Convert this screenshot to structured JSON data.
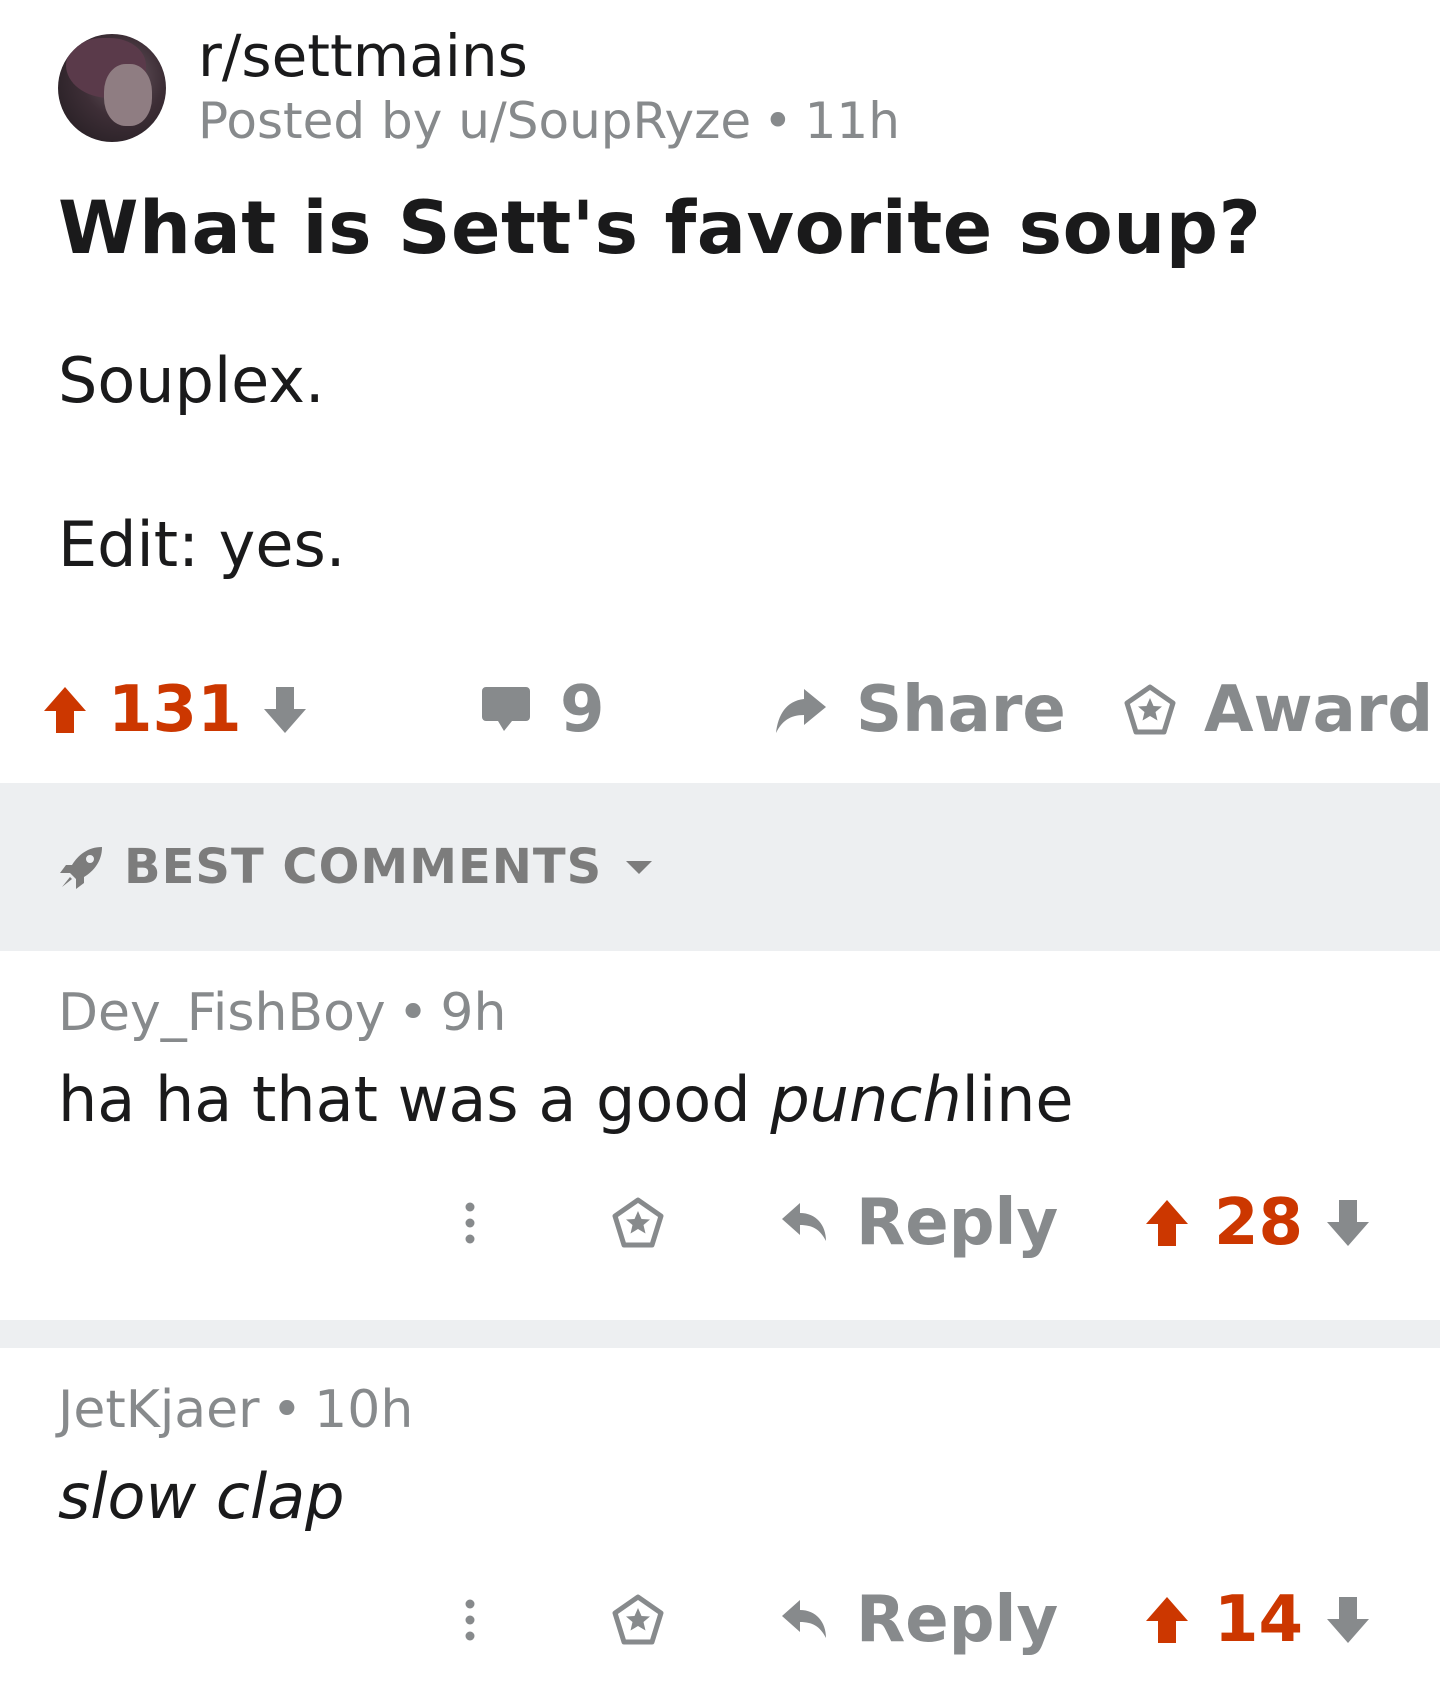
{
  "post": {
    "subreddit": "r/settmains",
    "posted_by": "Posted by u/SoupRyze",
    "age": "11h",
    "title": "What is Sett's favorite soup?",
    "body": [
      "Souplex.",
      "Edit: yes."
    ],
    "votes": "131",
    "comments": "9",
    "share_label": "Share",
    "award_label": "Award"
  },
  "sort": {
    "label": "BEST COMMENTS"
  },
  "comments": [
    {
      "author": "Dey_FishBoy",
      "age": "9h",
      "body_pre": "ha ha that was a good ",
      "body_italic": "punch",
      "body_post": "line",
      "reply_label": "Reply",
      "votes": "28"
    },
    {
      "author": "JetKjaer",
      "age": "10h",
      "body_italic": "slow clap",
      "reply_label": "Reply",
      "votes": "14"
    }
  ],
  "colors": {
    "upvote": "#cc3700",
    "muted": "#878a8c",
    "separator": "#edeff1"
  },
  "icons": [
    "upvote-arrow-icon",
    "downvote-arrow-icon",
    "comment-bubble-icon",
    "share-arrow-icon",
    "award-icon",
    "rocket-icon",
    "chevron-down-icon",
    "more-vertical-icon",
    "reply-arrow-icon"
  ]
}
